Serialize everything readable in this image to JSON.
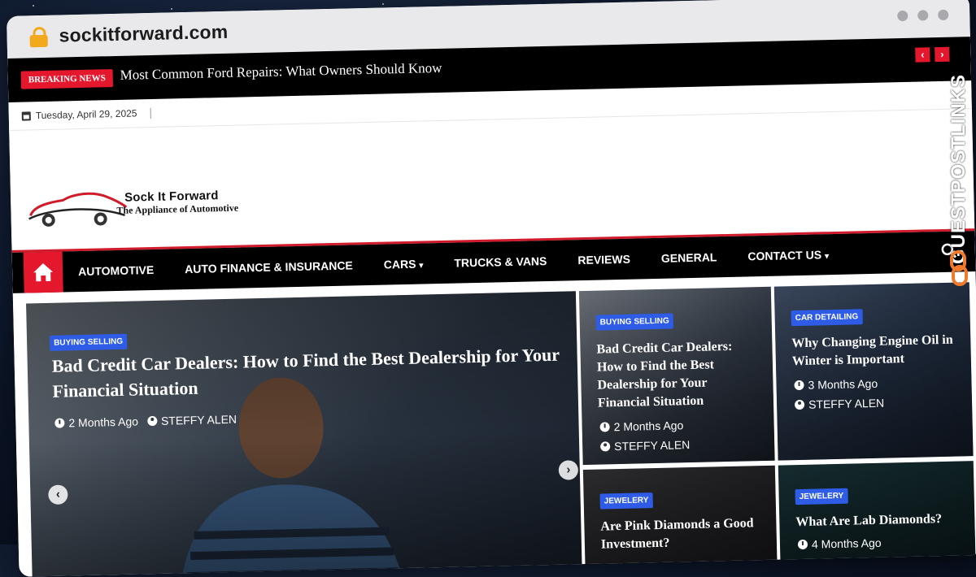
{
  "browser": {
    "url": "sockitforward.com"
  },
  "breaking": {
    "label": "BREAKING NEWS",
    "headline": "Most Common Ford Repairs: What Owners Should Know",
    "prev_icon": "chevron-left-icon",
    "next_icon": "chevron-right-icon",
    "prev_symbol": "‹",
    "next_symbol": "›"
  },
  "date": "Tuesday, April 29, 2025",
  "logo": {
    "name": "Sock It Forward",
    "tagline": "The Appliance of Automotive"
  },
  "menu": {
    "items": [
      {
        "label": "AUTOMOTIVE"
      },
      {
        "label": "AUTO FINANCE & INSURANCE"
      },
      {
        "label": "CARS",
        "dropdown": true
      },
      {
        "label": "TRUCKS & VANS"
      },
      {
        "label": "REVIEWS"
      },
      {
        "label": "GENERAL"
      },
      {
        "label": "CONTACT US",
        "dropdown": true
      }
    ]
  },
  "slider": {
    "category": "BUYING SELLING",
    "title": "Bad Credit Car Dealers: How to Find the Best Dealership for Your Financial Situation",
    "time": "2 Months Ago",
    "author": "STEFFY ALEN",
    "prev_symbol": "‹",
    "next_symbol": "›"
  },
  "cards": [
    {
      "category": "BUYING SELLING",
      "title": "Bad Credit Car Dealers: How to Find the Best Dealership for Your Financial Situation",
      "time": "2 Months Ago",
      "author": "STEFFY ALEN"
    },
    {
      "category": "CAR DETAILING",
      "title": "Why Changing Engine Oil in Winter is Important",
      "time": "3 Months Ago",
      "author": "STEFFY ALEN"
    },
    {
      "category": "JEWELERY",
      "title": "Are Pink Diamonds a Good Investment?"
    },
    {
      "category": "JEWELERY",
      "title": "What Are Lab Diamonds?",
      "time": "4 Months Ago"
    }
  ],
  "watermark": "GUESTPOSTLINKS",
  "colors": {
    "accent_red": "#e5172c",
    "category_blue": "#2e5ce6",
    "bar_black": "#000000"
  }
}
